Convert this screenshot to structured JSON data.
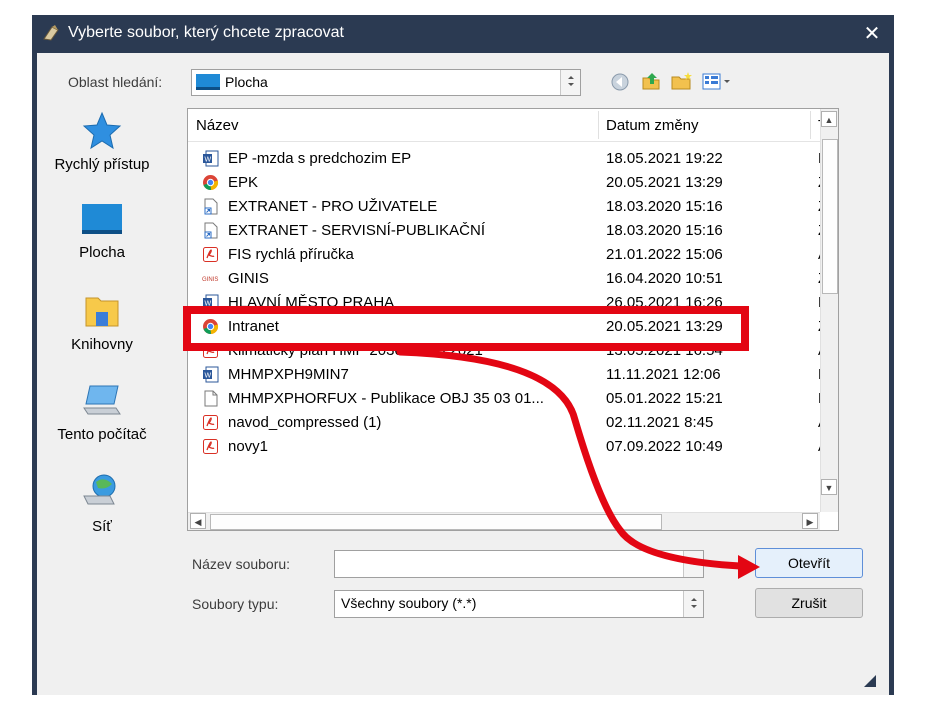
{
  "window": {
    "title": "Vyberte soubor, který chcete zpracovat",
    "close_glyph": "✕"
  },
  "look_in": {
    "label": "Oblast hledání:",
    "value": "Plocha"
  },
  "places": [
    {
      "label": "Rychlý přístup",
      "icon": "star-icon"
    },
    {
      "label": "Plocha",
      "icon": "desktop-icon"
    },
    {
      "label": "Knihovny",
      "icon": "library-icon"
    },
    {
      "label": "Tento počítač",
      "icon": "computer-icon"
    },
    {
      "label": "Síť",
      "icon": "network-icon"
    }
  ],
  "columns": {
    "name": "Název",
    "date": "Datum změny",
    "type": "Typ"
  },
  "files": [
    {
      "name": "EP -mzda s predchozim EP",
      "date": "18.05.2021 19:22",
      "type": "Do",
      "icon": "word-icon"
    },
    {
      "name": "EPK",
      "date": "20.05.2021 13:29",
      "type": "Zá",
      "icon": "chrome-icon"
    },
    {
      "name": "EXTRANET - PRO UŽIVATELE",
      "date": "18.03.2020 15:16",
      "type": "Zá",
      "icon": "shortcut-icon"
    },
    {
      "name": "EXTRANET - SERVISNÍ-PUBLIKAČNÍ",
      "date": "18.03.2020 15:16",
      "type": "Zá",
      "icon": "shortcut-icon"
    },
    {
      "name": "FIS rychlá příručka",
      "date": "21.01.2022 15:06",
      "type": "Ac",
      "icon": "pdf-icon"
    },
    {
      "name": "GINIS",
      "date": "16.04.2020 10:51",
      "type": "Zá",
      "icon": "ginis-icon"
    },
    {
      "name": "HLAVNÍ MĚSTO PRAHA",
      "date": "26.05.2021 16:26",
      "type": "Do",
      "icon": "word-icon"
    },
    {
      "name": "Intranet",
      "date": "20.05.2021 13:29",
      "type": "Zá",
      "icon": "chrome-icon"
    },
    {
      "name": "Klimaticky plan HMP 2030 - 10.5.2021",
      "date": "13.05.2021 16:54",
      "type": "Ac",
      "icon": "pdf-icon"
    },
    {
      "name": "MHMPXPH9MIN7",
      "date": "11.11.2021 12:06",
      "type": "Do",
      "icon": "word-icon"
    },
    {
      "name": "MHMPXPHORFUX - Publikace OBJ 35 03 01...",
      "date": "05.01.2022 15:21",
      "type": "Do",
      "icon": "blank-file-icon"
    },
    {
      "name": "navod_compressed (1)",
      "date": "02.11.2021 8:45",
      "type": "Ac",
      "icon": "pdf-icon"
    },
    {
      "name": "novy1",
      "date": "07.09.2022 10:49",
      "type": "Ac",
      "icon": "pdf-icon"
    }
  ],
  "filename": {
    "label": "Název souboru:",
    "value": ""
  },
  "filetype": {
    "label": "Soubory typu:",
    "value": "Všechny soubory (*.*)"
  },
  "buttons": {
    "open": "Otevřít",
    "cancel": "Zrušit"
  },
  "colors": {
    "titlebar": "#2b3a52",
    "highlight": "#e30613",
    "arrow": "#e30613"
  }
}
